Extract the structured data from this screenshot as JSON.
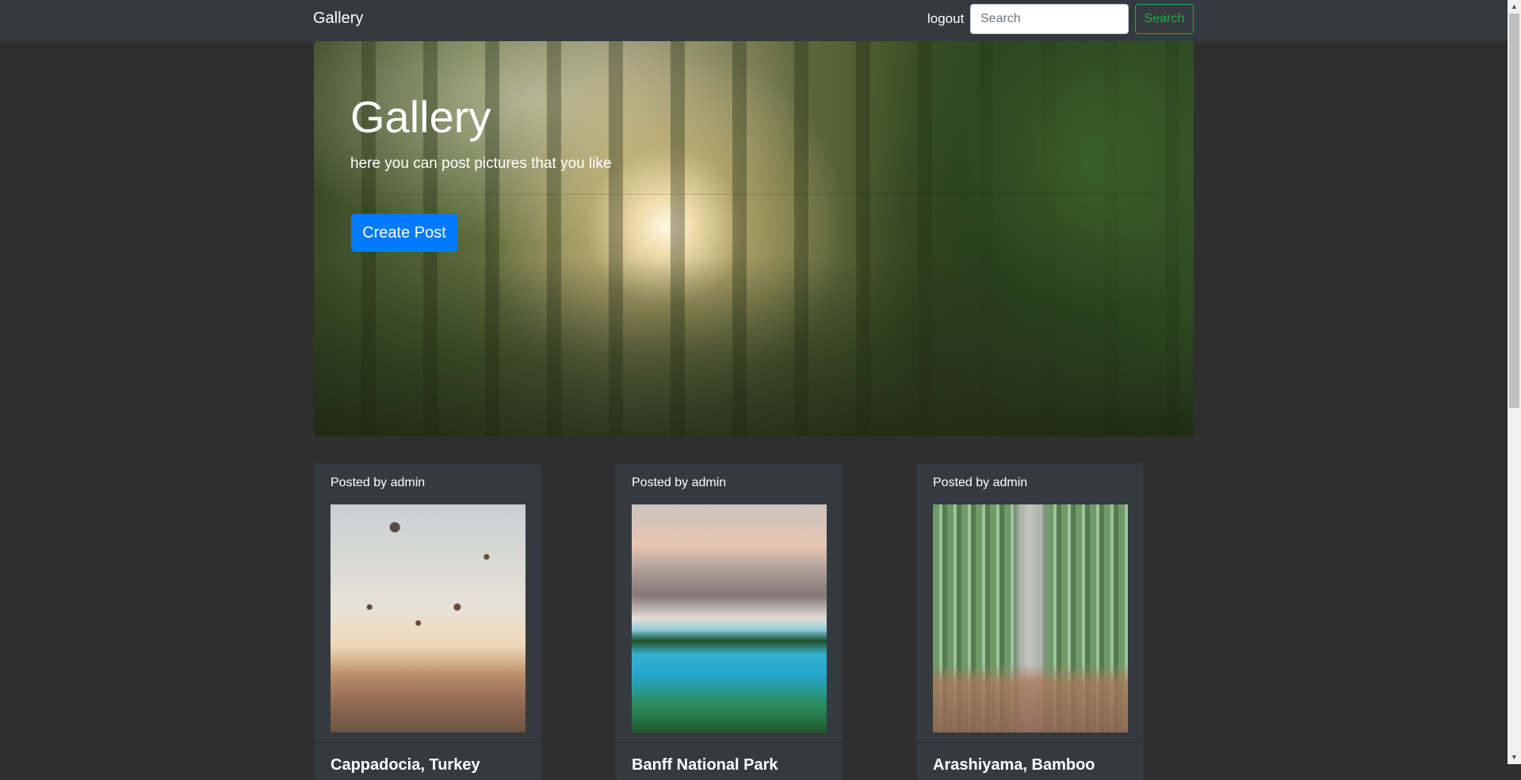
{
  "navbar": {
    "brand": "Gallery",
    "logout_label": "logout",
    "search_placeholder": "Search",
    "search_button_label": "Search"
  },
  "hero": {
    "title": "Gallery",
    "lead": "here you can post pictures that you like",
    "create_button_label": "Create Post"
  },
  "posts": [
    {
      "header": "Posted by admin",
      "title": "Cappadocia, Turkey",
      "image": "hot air balloons over rocky valley"
    },
    {
      "header": "Posted by admin",
      "title": "Banff National Park",
      "image": "turquoise mountain lake with pine trees"
    },
    {
      "header": "Posted by admin",
      "title": "Arashiyama, Bamboo",
      "image": "path through bamboo grove"
    }
  ],
  "colors": {
    "navbar_bg": "#343a40",
    "page_bg": "#2f2f2f",
    "primary": "#007bff",
    "success": "#28a745"
  }
}
